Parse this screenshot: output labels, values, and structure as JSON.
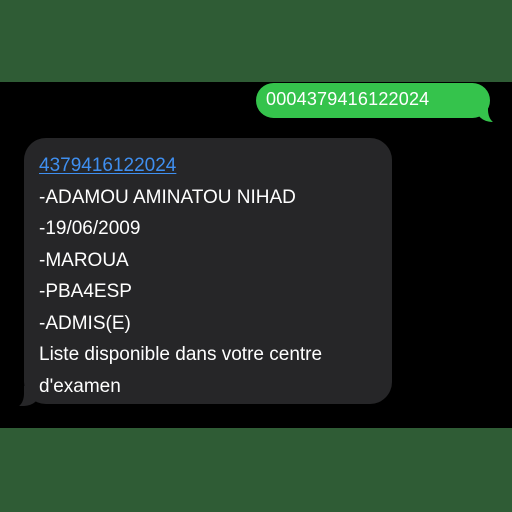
{
  "conversation": {
    "sent_message": "0004379416122024",
    "received_message": {
      "link": "4379416122024",
      "lines": [
        "-ADAMOU AMINATOU NIHAD",
        "-19/06/2009",
        "-MAROUA",
        "-PBA4ESP",
        "-ADMIS(E)"
      ],
      "footer": "Liste disponible dans votre centre d'examen"
    }
  },
  "colors": {
    "frame": "#2f5c35",
    "background": "#000000",
    "sent_bubble": "#35c34c",
    "received_bubble": "#262628",
    "link": "#3f8ff0"
  }
}
